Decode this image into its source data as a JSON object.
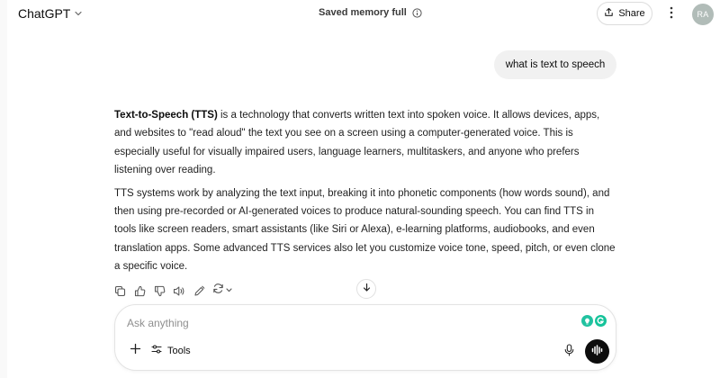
{
  "header": {
    "model_name": "ChatGPT",
    "memory_status": "Saved memory full",
    "share_label": "Share",
    "avatar_initials": "RA"
  },
  "conversation": {
    "user_message": "what is text to speech",
    "assistant": {
      "p1_bold": "Text-to-Speech (TTS)",
      "p1_rest": " is a technology that converts written text into spoken voice. It allows devices, apps, and websites to \"read aloud\" the text you see on a screen using a computer-generated voice. This is especially useful for visually impaired users, language learners, multitaskers, and anyone who prefers listening over reading.",
      "p2": "TTS systems work by analyzing the text input, breaking it into phonetic components (how words sound), and then using pre-recorded or AI-generated voices to produce natural-sounding speech. You can find TTS in tools like screen readers, smart assistants (like Siri or Alexa), e-learning platforms, audiobooks, and even translation apps. Some advanced TTS services also let you customize voice tone, speed, pitch, or even clone a specific voice."
    }
  },
  "composer": {
    "placeholder": "Ask anything",
    "tools_label": "Tools"
  },
  "icons": {
    "model_chevron": "chevron-down-icon",
    "memory_info": "info-icon",
    "share": "share-icon",
    "more": "more-vertical-icon",
    "actions": [
      "copy-icon",
      "thumbs-up-icon",
      "thumbs-down-icon",
      "read-aloud-icon",
      "edit-icon",
      "regenerate-icon"
    ],
    "scroll": "arrow-down-icon",
    "plus": "plus-icon",
    "tools": "sliders-icon",
    "mic": "mic-icon",
    "voice": "voice-mode-icon",
    "extensions": [
      "bulb-extension-icon",
      "grammarly-icon"
    ]
  },
  "colors": {
    "text": "#0d0d0d",
    "bubble": "#f1f1f1",
    "avatar": "#b1bcb8",
    "voice_button": "#0d0d0d",
    "extension": "#15c39a"
  }
}
